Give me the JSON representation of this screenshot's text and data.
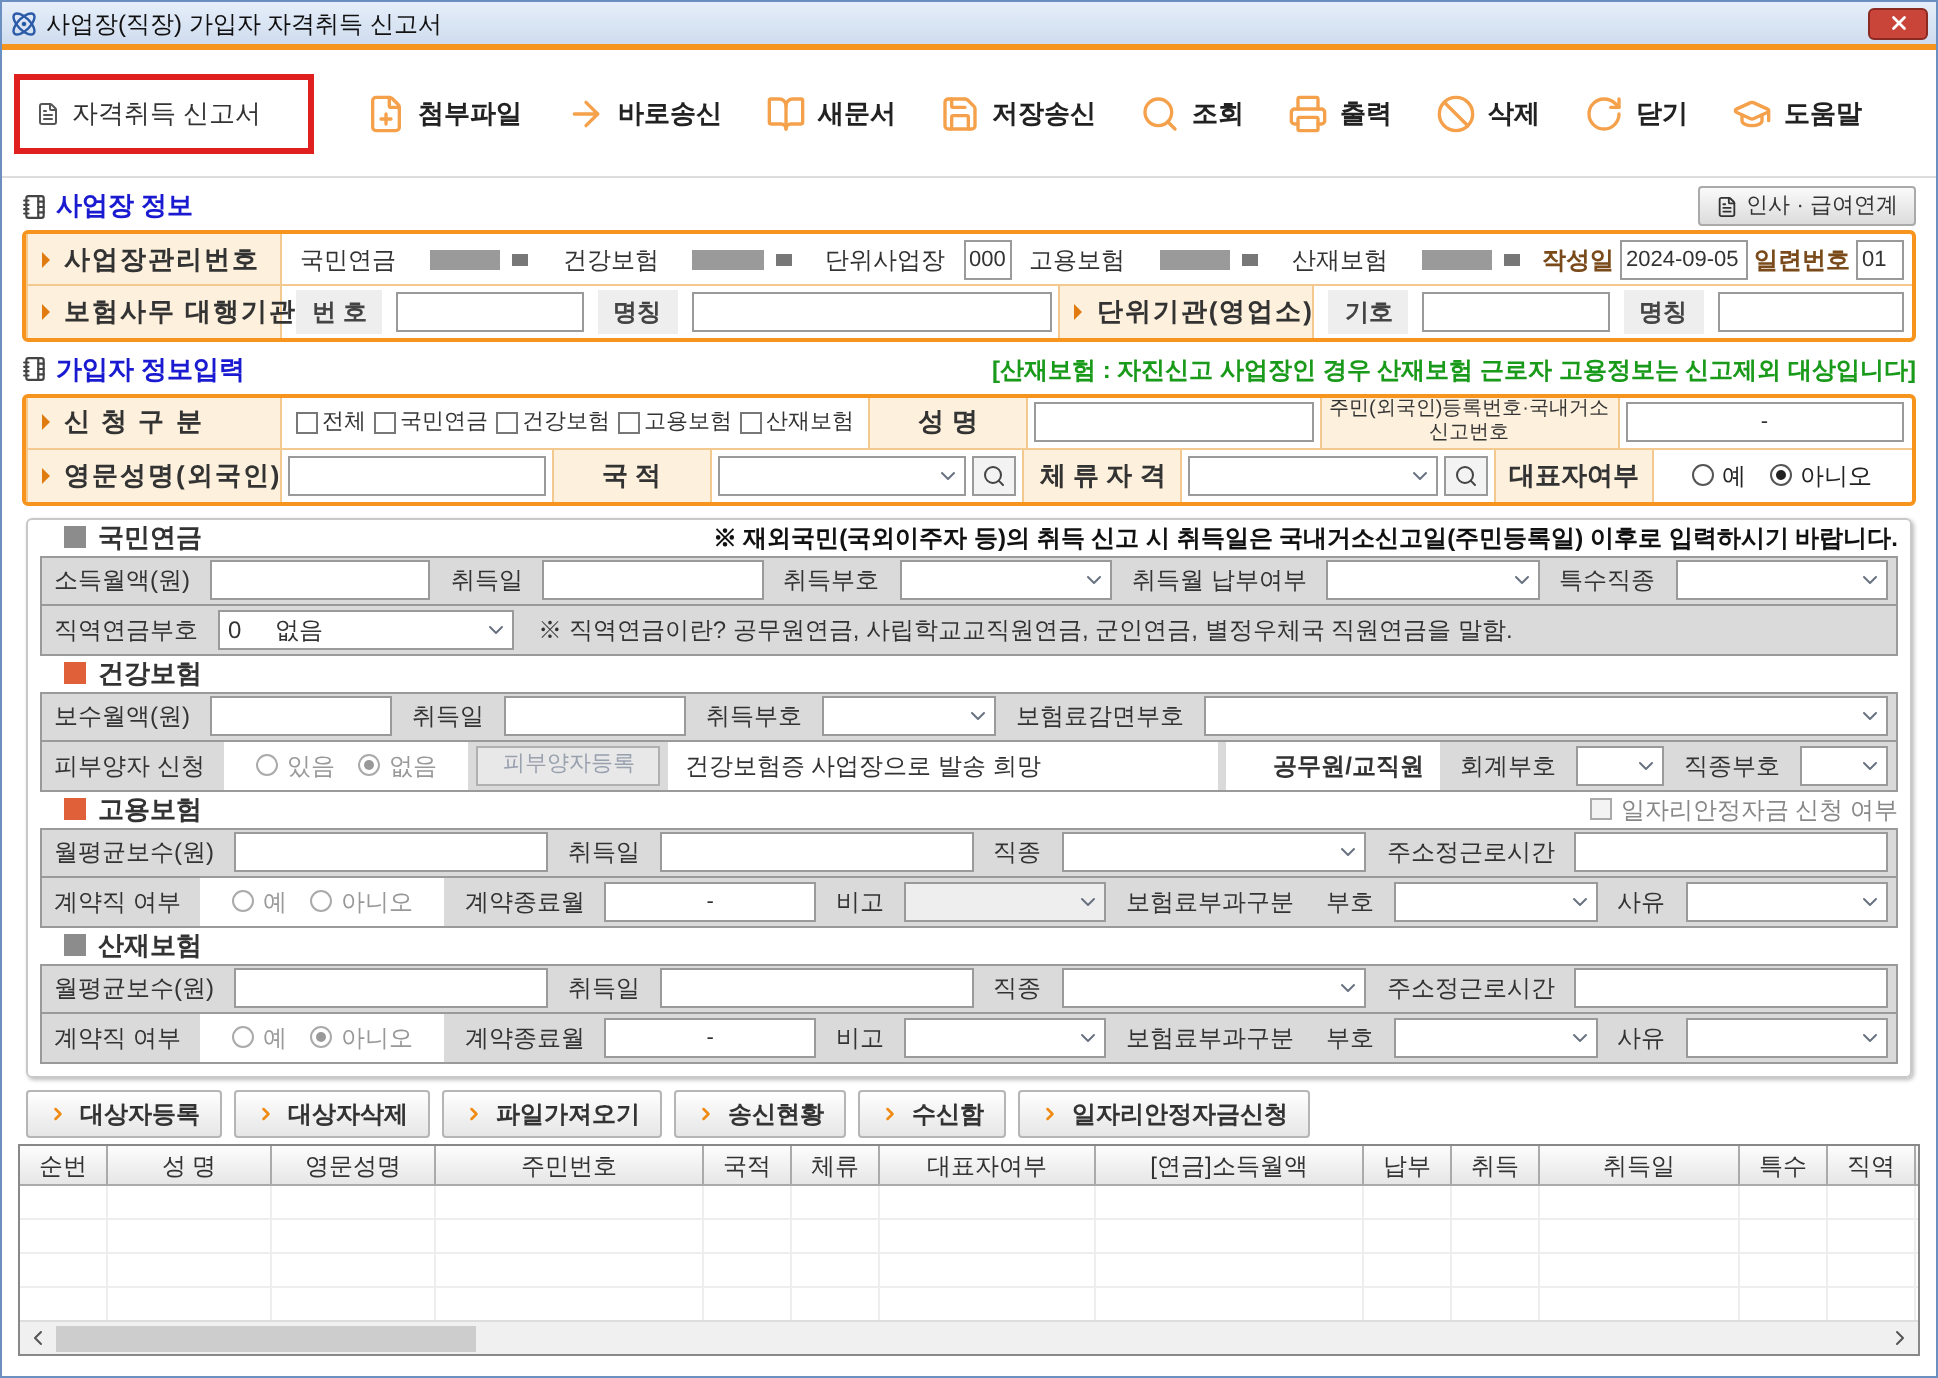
{
  "window": {
    "title": "사업장(직장) 가입자 자격취득 신고서"
  },
  "toolbar": [
    {
      "label": "자격취득 신고서",
      "selected": true
    },
    {
      "label": "첨부파일",
      "selected": false
    },
    {
      "label": "바로송신",
      "selected": false
    },
    {
      "label": "새문서",
      "selected": false
    },
    {
      "label": "저장송신",
      "selected": false
    },
    {
      "label": "조회",
      "selected": false
    },
    {
      "label": "출력",
      "selected": false
    },
    {
      "label": "삭제",
      "selected": false
    },
    {
      "label": "닫기",
      "selected": false
    },
    {
      "label": "도움말",
      "selected": false
    }
  ],
  "business_info": {
    "title": "사업장 정보",
    "button": "인사 · 급여연계",
    "upper_line": {
      "items": [
        {
          "kind": "head",
          "text": "사업장관리번호"
        },
        {
          "kind": "label",
          "text": "국민연금"
        },
        {
          "kind": "masked"
        },
        {
          "kind": "label",
          "text": "건강보험"
        },
        {
          "kind": "masked"
        },
        {
          "kind": "label",
          "text": "단위사업장"
        },
        {
          "kind": "small_input",
          "value": "000"
        },
        {
          "kind": "label",
          "text": "고용보험"
        },
        {
          "kind": "masked"
        },
        {
          "kind": "label",
          "text": "산재보험"
        },
        {
          "kind": "masked"
        },
        {
          "kind": "strong",
          "text": "작성일"
        },
        {
          "kind": "date_input",
          "value": "2024-09-05"
        },
        {
          "kind": "strong",
          "text": "일련번호"
        },
        {
          "kind": "small_input",
          "value": "01"
        }
      ]
    },
    "lower_line": {
      "items": [
        {
          "kind": "head",
          "text": "보험사무 대행기관"
        },
        {
          "kind": "tag",
          "text": "번 호"
        },
        {
          "kind": "input"
        },
        {
          "kind": "tag",
          "text": "명칭"
        },
        {
          "kind": "wide_input"
        },
        {
          "kind": "head",
          "text": "단위기관(영업소)"
        },
        {
          "kind": "tag",
          "text": "기호"
        },
        {
          "kind": "input"
        },
        {
          "kind": "tag",
          "text": "명칭"
        },
        {
          "kind": "input"
        }
      ]
    }
  },
  "member_info": {
    "title": "가입자 정보입력",
    "notice": "[산재보험 : 자진신고 사업장인 경우 산재보험 근로자 고용정보는 신고제외 대상입니다]",
    "upper_line": {
      "items": [
        {
          "kind": "head",
          "text": "신 청 구 분"
        },
        {
          "kind": "check_group",
          "options": [
            {
              "label": "전체",
              "checked": false
            },
            {
              "label": "국민연금",
              "checked": false
            },
            {
              "label": "건강보험",
              "checked": false
            },
            {
              "label": "고용보험",
              "checked": false
            },
            {
              "label": "산재보험",
              "checked": false
            }
          ]
        },
        {
          "kind": "head2",
          "text": "성 명"
        },
        {
          "kind": "input"
        },
        {
          "kind": "small_label",
          "text": "주민(외국인)등록번호·국내거소신고번호"
        },
        {
          "kind": "split_input",
          "value": "-"
        }
      ]
    },
    "lower_line": {
      "items": [
        {
          "kind": "head",
          "text": "영문성명(외국인)"
        },
        {
          "kind": "input"
        },
        {
          "kind": "head2",
          "text": "국 적"
        },
        {
          "kind": "select"
        },
        {
          "kind": "search"
        },
        {
          "kind": "head2",
          "text": "체 류 자 격"
        },
        {
          "kind": "select"
        },
        {
          "kind": "search"
        },
        {
          "kind": "head2",
          "text": "대표자여부"
        },
        {
          "kind": "radio_group",
          "disabled": false,
          "options": [
            {
              "label": "예",
              "selected": false
            },
            {
              "label": "아니오",
              "selected": true
            }
          ]
        }
      ]
    }
  },
  "details": [
    {
      "title": "국민연금",
      "color": "#8c8c8c",
      "notice": "※ 재외국민(국외이주자 등)의 취득 신고 시 취득일은 국내거소신고일(주민등록일) 이후로 입력하시기 바랍니다.",
      "upper_line": {
        "items": [
          {
            "kind": "label",
            "text": "소득월액(원)"
          },
          {
            "kind": "input"
          },
          {
            "kind": "label",
            "text": "취득일"
          },
          {
            "kind": "input"
          },
          {
            "kind": "label",
            "text": "취득부호"
          },
          {
            "kind": "select"
          },
          {
            "kind": "label",
            "text": "취득월 납부여부"
          },
          {
            "kind": "select"
          },
          {
            "kind": "label",
            "text": "특수직종"
          },
          {
            "kind": "select"
          }
        ]
      },
      "lower_line": {
        "items": [
          {
            "kind": "label",
            "text": "직역연금부호"
          },
          {
            "kind": "code_select",
            "value": "0",
            "option": "없음"
          },
          {
            "kind": "note",
            "text": "※ 직역연금이란? 공무원연금, 사립학교교직원연금, 군인연금, 별정우체국 직원연금을 말함."
          }
        ]
      }
    },
    {
      "title": "건강보험",
      "color": "#e0603a",
      "upper_line": {
        "items": [
          {
            "kind": "label",
            "text": "보수월액(원)"
          },
          {
            "kind": "input"
          },
          {
            "kind": "label",
            "text": "취득일"
          },
          {
            "kind": "input"
          },
          {
            "kind": "label",
            "text": "취득부호"
          },
          {
            "kind": "select"
          },
          {
            "kind": "label",
            "text": "보험료감면부호"
          },
          {
            "kind": "wide_select"
          }
        ]
      },
      "lower_line": {
        "items": [
          {
            "kind": "label",
            "text": "피부양자 신청"
          },
          {
            "kind": "radio_group",
            "disabled": true,
            "options": [
              {
                "label": "있음",
                "selected": false
              },
              {
                "label": "없음",
                "selected": true
              }
            ]
          },
          {
            "kind": "button",
            "text": "피부양자등록",
            "disabled": true
          },
          {
            "kind": "text",
            "text": "건강보험증 사업장으로 발송 희망"
          },
          {
            "kind": "strong_white",
            "text": "공무원/교직원"
          },
          {
            "kind": "label",
            "text": "회계부호"
          },
          {
            "kind": "tiny_select"
          },
          {
            "kind": "label",
            "text": "직종부호"
          },
          {
            "kind": "tiny_select"
          }
        ]
      }
    },
    {
      "title": "고용보험",
      "color": "#e0603a",
      "option": {
        "label": "일자리안정자금 신청 여부",
        "checked": false
      },
      "upper_line": {
        "items": [
          {
            "kind": "label",
            "text": "월평균보수(원)"
          },
          {
            "kind": "input"
          },
          {
            "kind": "label",
            "text": "취득일"
          },
          {
            "kind": "input"
          },
          {
            "kind": "label",
            "text": "직종"
          },
          {
            "kind": "select"
          },
          {
            "kind": "label",
            "text": "주소정근로시간"
          },
          {
            "kind": "input"
          }
        ]
      },
      "lower_line": {
        "items": [
          {
            "kind": "label",
            "text": "계약직 여부"
          },
          {
            "kind": "radio_group",
            "disabled": true,
            "options": [
              {
                "label": "예",
                "selected": false
              },
              {
                "label": "아니오",
                "selected": false
              }
            ]
          },
          {
            "kind": "label",
            "text": "계약종료월"
          },
          {
            "kind": "split_input",
            "value": "-"
          },
          {
            "kind": "label",
            "text": "비고"
          },
          {
            "kind": "select",
            "disabled": true
          },
          {
            "kind": "label",
            "text": "보험료부과구분"
          },
          {
            "kind": "label",
            "text": "부호"
          },
          {
            "kind": "select"
          },
          {
            "kind": "label",
            "text": "사유"
          },
          {
            "kind": "select"
          }
        ]
      }
    },
    {
      "title": "산재보험",
      "color": "#8c8c8c",
      "upper_line": {
        "items": [
          {
            "kind": "label",
            "text": "월평균보수(원)"
          },
          {
            "kind": "input"
          },
          {
            "kind": "label",
            "text": "취득일"
          },
          {
            "kind": "input"
          },
          {
            "kind": "label",
            "text": "직종"
          },
          {
            "kind": "select"
          },
          {
            "kind": "label",
            "text": "주소정근로시간"
          },
          {
            "kind": "input"
          }
        ]
      },
      "lower_line": {
        "items": [
          {
            "kind": "label",
            "text": "계약직 여부"
          },
          {
            "kind": "radio_group",
            "disabled": true,
            "options": [
              {
                "label": "예",
                "selected": false
              },
              {
                "label": "아니오",
                "selected": true
              }
            ]
          },
          {
            "kind": "label",
            "text": "계약종료월"
          },
          {
            "kind": "split_input",
            "value": "-"
          },
          {
            "kind": "label",
            "text": "비고"
          },
          {
            "kind": "select",
            "disabled": false
          },
          {
            "kind": "label",
            "text": "보험료부과구분"
          },
          {
            "kind": "label",
            "text": "부호"
          },
          {
            "kind": "select"
          },
          {
            "kind": "label",
            "text": "사유"
          },
          {
            "kind": "select"
          }
        ]
      }
    }
  ],
  "actions": [
    "대상자등록",
    "대상자삭제",
    "파일가져오기",
    "송신현황",
    "수신함",
    "일자리안정자금신청"
  ],
  "table": {
    "columns": [
      "순번",
      "성 명",
      "영문성명",
      "주민번호",
      "국적",
      "체류",
      "대표자여부",
      "[연금]소득월액",
      "납부",
      "취득",
      "취득일",
      "특수",
      "직역"
    ]
  }
}
